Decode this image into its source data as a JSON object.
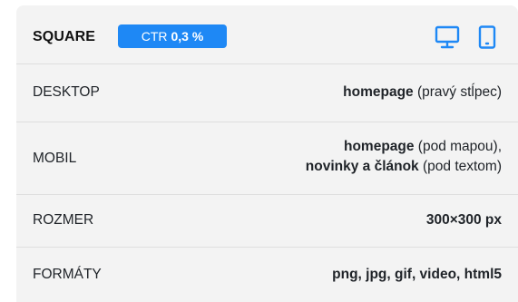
{
  "header": {
    "title": "SQUARE",
    "ctr_prefix": "CTR",
    "ctr_value": "0,3 %",
    "icons": [
      "desktop-icon",
      "mobile-icon"
    ],
    "accent_color": "#1e88f5"
  },
  "rows": [
    {
      "label": "DESKTOP",
      "value_lines": [
        {
          "bold": "homepage",
          "normal": " (pravý stĺpec)"
        }
      ]
    },
    {
      "label": "MOBIL",
      "value_lines": [
        {
          "bold": "homepage",
          "normal": " (pod mapou),"
        },
        {
          "bold": "novinky a článok",
          "normal": " (pod textom)"
        }
      ]
    },
    {
      "label": "ROZMER",
      "value_lines": [
        {
          "bold": "300×300 px",
          "normal": ""
        }
      ]
    },
    {
      "label": "FORMÁTY",
      "value_lines": [
        {
          "bold": "png, jpg, gif, video, html5",
          "normal": ""
        }
      ]
    }
  ]
}
